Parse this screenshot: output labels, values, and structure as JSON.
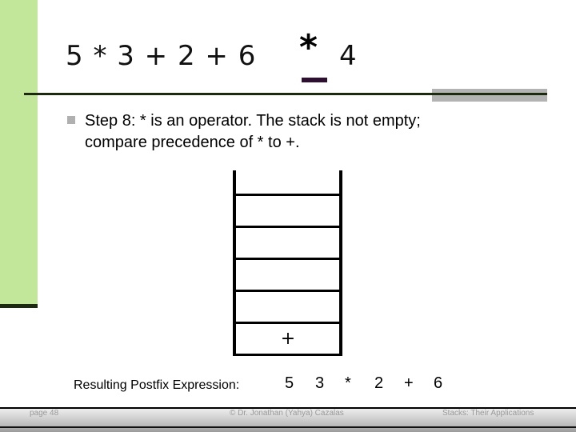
{
  "slide": {
    "title_tokens_before": "5 * 3 + 2 + 6",
    "highlighted_token": "*",
    "title_tokens_after": "4",
    "bullet_text_line1": "Step 8:  * is an operator.  The stack is not empty;",
    "bullet_text_line2": "compare precedence of * to +.",
    "stack": {
      "capacity_cells": 5,
      "items_bottom_to_top": [
        "+"
      ]
    },
    "result_label": "Resulting Postfix Expression:",
    "result_tokens": [
      "5",
      "3",
      "*",
      "2",
      "+",
      "6"
    ]
  },
  "footer": {
    "page": "page 48",
    "author": "© Dr. Jonathan (Yahya) Cazalas",
    "topic": "Stacks: Their Applications"
  },
  "colors": {
    "sidebar_green": "#c2e69a",
    "rule_dark": "#1c2a10",
    "highlight_underline": "#2e0f32",
    "bullet_gray": "#b0b0b0"
  }
}
